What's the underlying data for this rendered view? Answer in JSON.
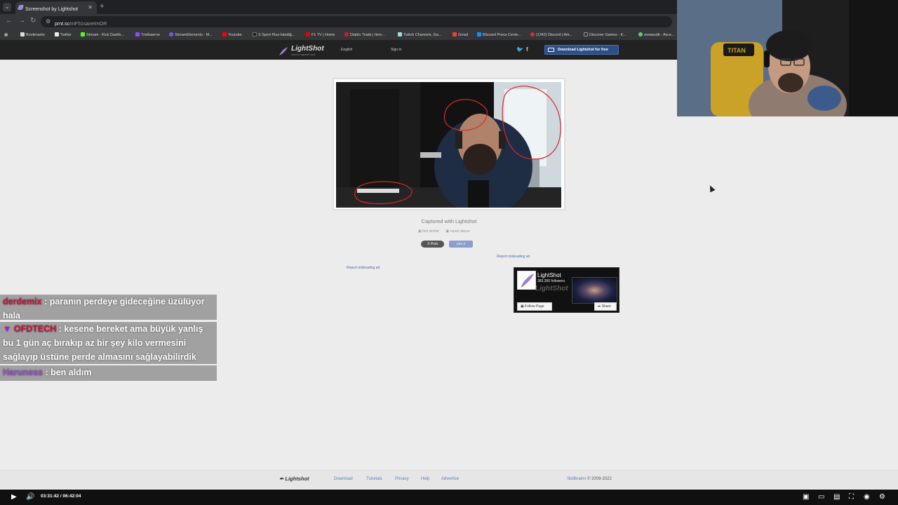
{
  "browser": {
    "tab_title": "Screenshot by Lightshot",
    "url_host": "prnt.sc",
    "url_path": "/mF51saneImOR",
    "bookmarks": [
      "Bookmarks",
      "Twitter",
      "Stream - Kick Dashb...",
      "Trielbaerne",
      "StreamElements - M...",
      "Youtube",
      "S Sport Plus-İstediğ...",
      "F1 TV | Home",
      "Diablo Trade | Item...",
      "Twitch Channels, Ga...",
      "Gmail",
      "Blizzard Press Cente...",
      "(1342) Discord | Ark...",
      "Discover Games - K...",
      "wowaudit - Asce..."
    ]
  },
  "lightshot": {
    "logo": "LightShot",
    "tagline": "screen capture tool",
    "language": "English",
    "signin": "Sign in",
    "download_btn": "Download Lightshot for free",
    "captured": "Captured with Lightshot",
    "find_similar": "find similar",
    "report_abuse": "report abuse",
    "post_btn": "X Post",
    "like_btn": "Like 0",
    "report_ad_1": "Report misleading ad",
    "report_ad_2": "Report misleading ad",
    "fb_widget": {
      "title": "LightShot",
      "followers": "383,356 followers",
      "follow_btn": "Follow Page",
      "share_btn": "Share"
    }
  },
  "chat": [
    {
      "user": "derdemix",
      "user_color": "#c8193c",
      "message": " : paranın perdeye gideceğine üzülüyor hala"
    },
    {
      "user": "OFDTECH",
      "user_color": "#d0133a",
      "message": " : kesene bereket ama büyük yanlış bu 1 gün aç bırakıp az bir şey kilo vermesini sağlayıp üstüne perde almasını sağlayabilirdik"
    },
    {
      "user": "Haruness",
      "user_color": "#9b59d0",
      "message": " : ben aldım"
    }
  ],
  "footer": {
    "logo": "Lightshot",
    "links": [
      "Download",
      "Tutorials",
      "Privacy",
      "Help",
      "Advertise"
    ],
    "company": "Skillbrains",
    "copyright": " © 2009-2022"
  },
  "player": {
    "time": "03:31:42 / 06:42:04"
  },
  "colors": {
    "page_bg": "#ececec",
    "header_bg": "#222222",
    "download_btn": "#2c4f86",
    "link": "#5b7fb8"
  }
}
